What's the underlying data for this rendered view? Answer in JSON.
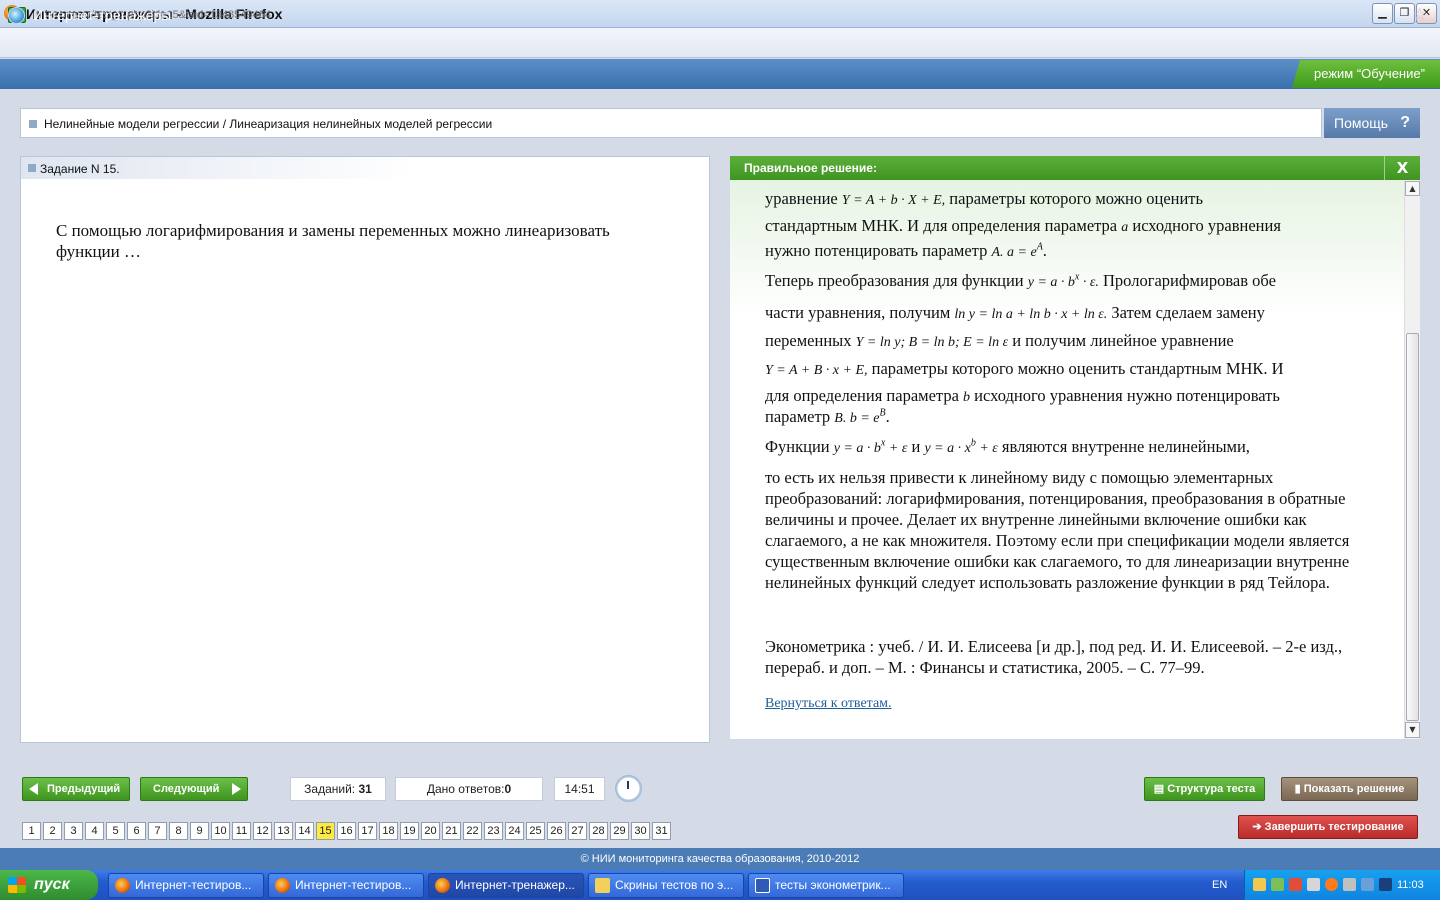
{
  "window": {
    "title": "Интернет-тренажеры - Mozilla Firefox",
    "min": "▁",
    "max": "❐",
    "close": "✕"
  },
  "browser": {
    "url_prefix": "tt.",
    "url_domain": "i-exam.ru",
    "url_path": "/test_tt.php?id=15&tsid=1348549464"
  },
  "app": {
    "title": "Интернет-тренажеры",
    "mode": "режим “Обучение”"
  },
  "breadcrumb": "Нелинейные модели регрессии / Линеаризация нелинейных моделей регрессии",
  "help": {
    "label": "Помощь",
    "icon": "?"
  },
  "task": {
    "title": "Задание N 15.",
    "question": "С помощью логарифмирования и замены переменных можно линеаризовать функции …"
  },
  "solution": {
    "header": "Правильное решение:",
    "close": "X",
    "l1a": "уравнение",
    "l1f": "Y = A + b · X + E,",
    "l1b": "параметры которого можно оценить",
    "l2": "стандартным МНК. И для определения параметра",
    "l2f": "a",
    "l2b": "исходного уравнения",
    "l3": "нужно потенцировать параметр",
    "l3f": "A.  a = e",
    "l3s": "A",
    "l3e": ".",
    "l4a": "Теперь преобразования для функции",
    "l4f": "y = a · b",
    "l4s": "x",
    "l4f2": " · ε.",
    "l4b": "Прологарифмировав обе",
    "l5a": "части уравнения, получим",
    "l5f": "ln y = ln a + ln b · x + ln ε.",
    "l5b": "Затем сделаем замену",
    "l6a": "переменных",
    "l6f": "Y = ln y; B = ln b; E = ln ε",
    "l6b": "и получим линейное уравнение",
    "l7f": "Y = A + B · x + E,",
    "l7b": "параметры которого можно оценить стандартным МНК. И",
    "l8a": "для определения параметра",
    "l8f": "b",
    "l8b": "исходного уравнения нужно потенцировать",
    "l9a": "параметр",
    "l9f": "B.  b = e",
    "l9s": "B",
    "l9e": ".",
    "l10a": "Функции",
    "l10f1": "y = a · b",
    "l10s1": "x",
    "l10f1b": " + ε",
    "l10m": "и",
    "l10f2": "y = a · x",
    "l10s2": "b",
    "l10f2b": " + ε",
    "l10b": "являются внутренне нелинейными,",
    "tail": "то есть их нельзя привести к линейному виду с помощью элементарных преобразований: логарифмирования, потенцирования, преобразования в обратные величины и прочее. Делает их внутренне линейными включение ошибки как слагаемого, а не как множителя. Поэтому если при спецификации модели является существенным включение ошибки как слагаемого, то для линеаризации внутренне нелинейных функций следует использовать разложение функции в ряд Тейлора.",
    "reference": "Эконометрика : учеб. / И. И. Елисеева [и др.], под ред. И. И. Елисеевой. – 2-е изд., перераб. и доп. – М. : Финансы и статистика, 2005. – С. 77–99.",
    "back_link": "Вернуться к ответам."
  },
  "controls": {
    "prev": "Предыдущий",
    "next": "Следующий",
    "tasks_label": "Заданий:",
    "tasks_value": "31",
    "answers_label": "Дано ответов:",
    "answers_value": "0",
    "timer": "14:51",
    "structure": "Структура теста",
    "show_solution": "Показать решение",
    "finish": "Завершить тестирование"
  },
  "pages": [
    "1",
    "2",
    "3",
    "4",
    "5",
    "6",
    "7",
    "8",
    "9",
    "10",
    "11",
    "12",
    "13",
    "14",
    "15",
    "16",
    "17",
    "18",
    "19",
    "20",
    "21",
    "22",
    "23",
    "24",
    "25",
    "26",
    "27",
    "28",
    "29",
    "30",
    "31"
  ],
  "current_page": "15",
  "copyright": "© НИИ мониторинга качества образования, 2010-2012",
  "taskbar": {
    "start": "пуск",
    "items": [
      "Интернет-тестиров...",
      "Интернет-тестиров...",
      "Интернет-тренажер...",
      "Скрины тестов по э...",
      "тесты эконометрик..."
    ],
    "lang": "EN",
    "time": "11:03"
  },
  "colors": {
    "accent_green": "#4fa52c",
    "header_blue": "#4a7fbf",
    "current_page": "#ffea40"
  }
}
